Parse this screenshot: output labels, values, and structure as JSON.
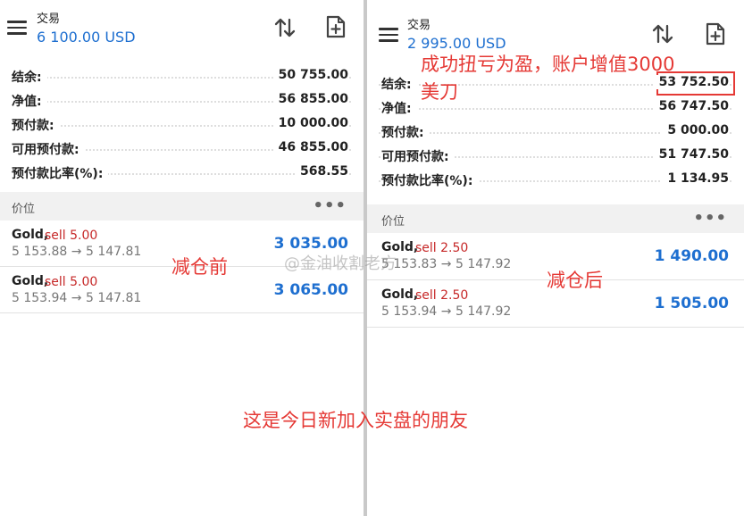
{
  "left": {
    "header": {
      "title": "交易",
      "balance": "6 100.00 USD"
    },
    "account": [
      {
        "label": "结余:",
        "value": "50 755.00"
      },
      {
        "label": "净值:",
        "value": "56 855.00"
      },
      {
        "label": "预付款:",
        "value": "10 000.00"
      },
      {
        "label": "可用预付款:",
        "value": "46 855.00"
      },
      {
        "label": "预付款比率(%):",
        "value": "568.55"
      }
    ],
    "section": {
      "label": "价位"
    },
    "positions": [
      {
        "symbol": "Gold,",
        "side": "sell 5.00",
        "prices": "5 153.88 → 5 147.81",
        "profit": "3 035.00"
      },
      {
        "symbol": "Gold,",
        "side": "sell 5.00",
        "prices": "5 153.94 → 5 147.81",
        "profit": "3 065.00"
      }
    ]
  },
  "right": {
    "header": {
      "title": "交易",
      "balance": "2 995.00 USD"
    },
    "account": [
      {
        "label": "结余:",
        "value": "53 752.50"
      },
      {
        "label": "净值:",
        "value": "56 747.50"
      },
      {
        "label": "预付款:",
        "value": "5 000.00"
      },
      {
        "label": "可用预付款:",
        "value": "51 747.50"
      },
      {
        "label": "预付款比率(%):",
        "value": "1 134.95"
      }
    ],
    "section": {
      "label": "价位"
    },
    "positions": [
      {
        "symbol": "Gold,",
        "side": "sell 2.50",
        "prices": "5 153.83 → 5 147.92",
        "profit": "1 490.00"
      },
      {
        "symbol": "Gold,",
        "side": "sell 2.50",
        "prices": "5 153.94 → 5 147.92",
        "profit": "1 505.00"
      }
    ]
  },
  "annotations": {
    "before": "减仓前",
    "after": "减仓后",
    "success_line1": "成功扭亏为盈，账户增值3000",
    "success_line2": "美刀",
    "bottom": "这是今日新加入实盘的朋友"
  },
  "watermark": "@金油收割老方",
  "icons": {
    "menu": "hamburger-menu-icon",
    "sort": "sort-arrows-icon",
    "new_order": "new-order-file-icon"
  },
  "colors": {
    "accent_blue": "#1e6fd0",
    "sell_red": "#c62828",
    "annotation_red": "#e53935"
  }
}
